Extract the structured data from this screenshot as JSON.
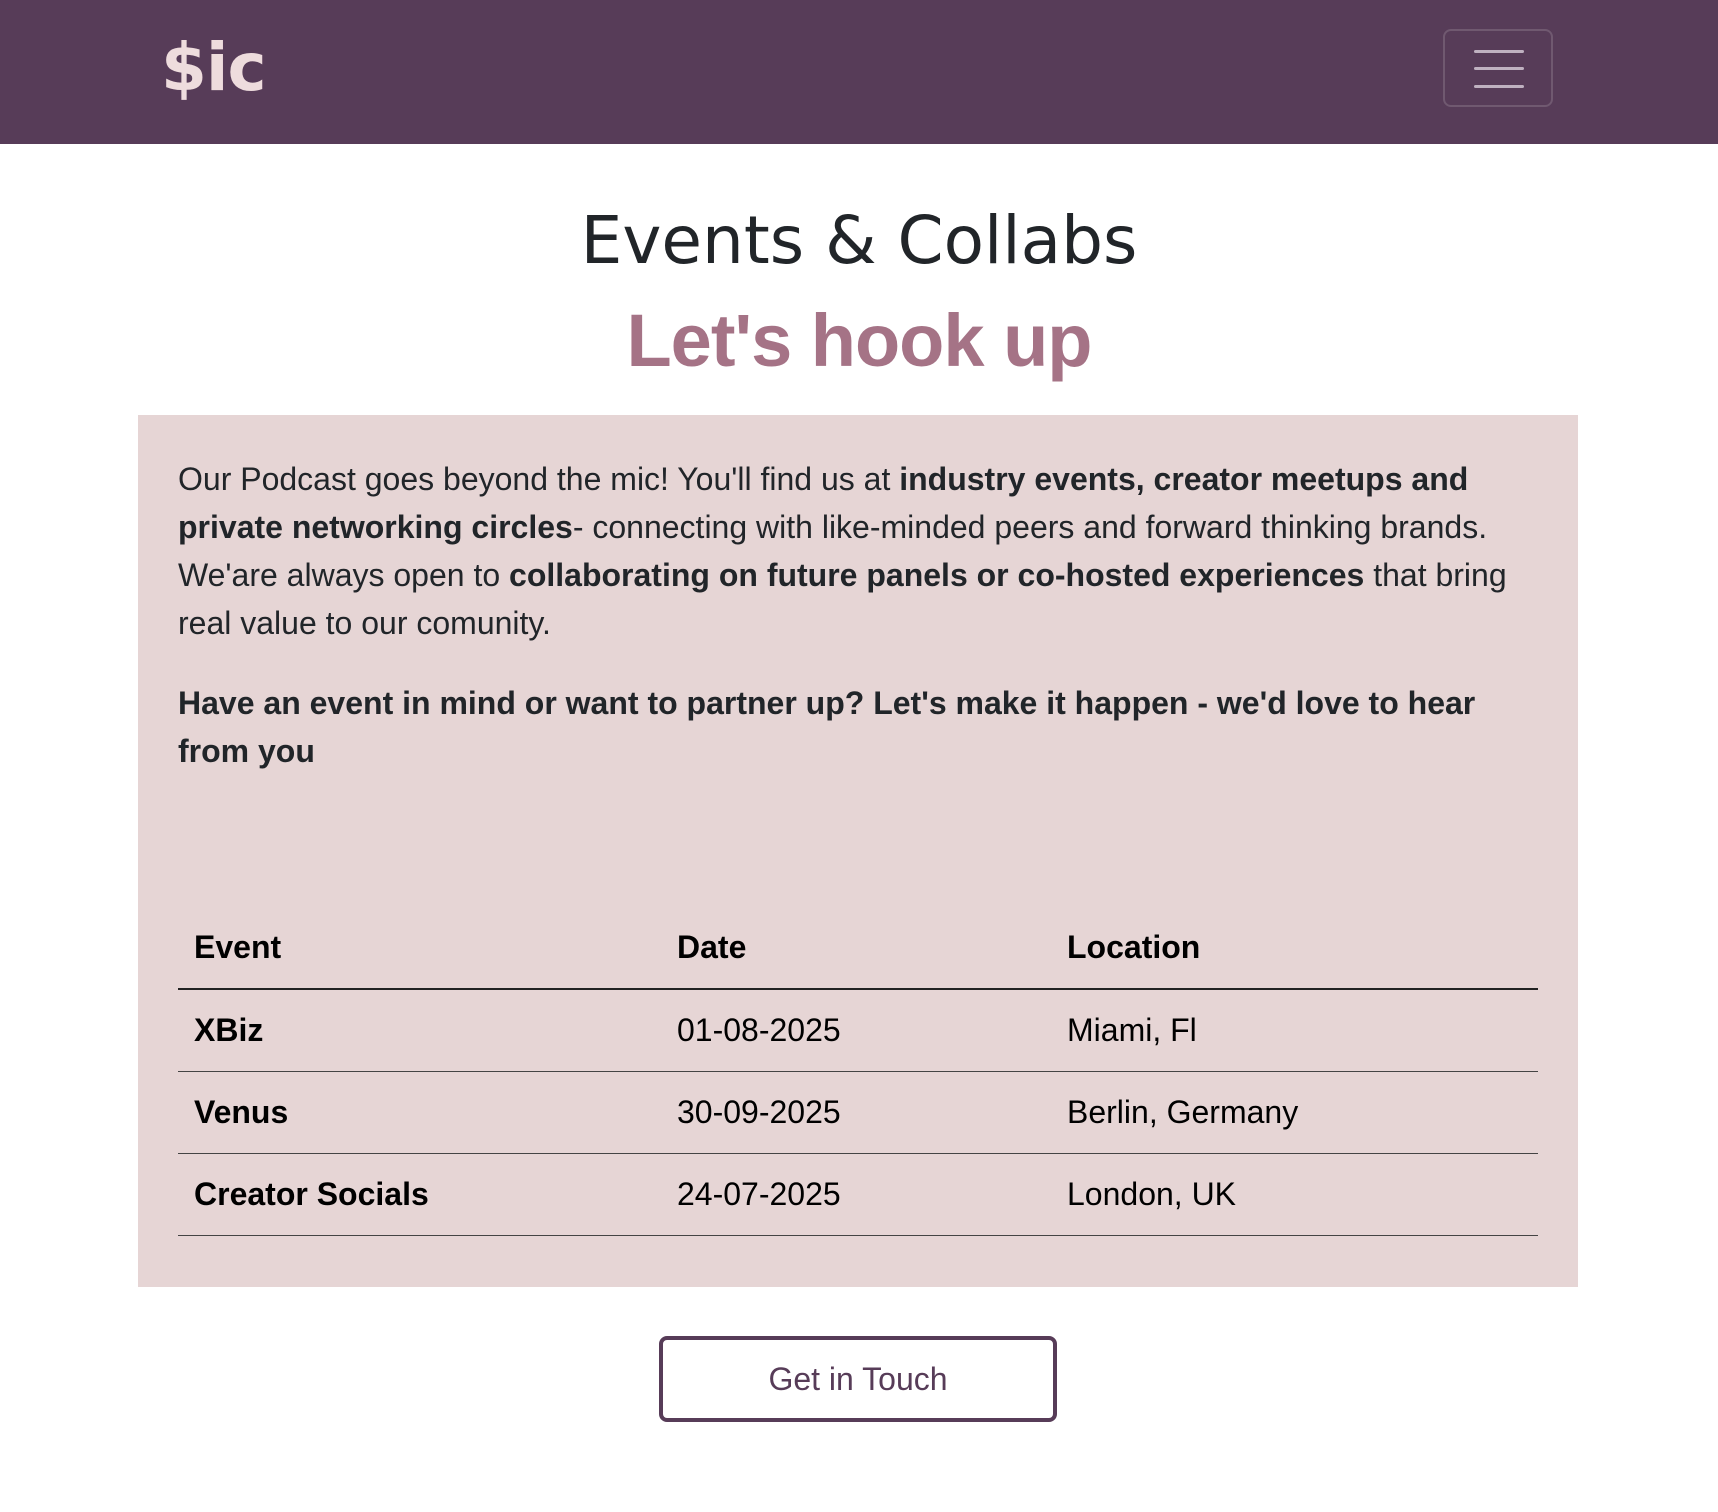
{
  "navbar": {
    "brand": "$ic",
    "toggle_icon": "hamburger-menu-icon",
    "background": "#573c58"
  },
  "hero": {
    "title": "Events & Collabs",
    "subtitle": "Let's hook up"
  },
  "intro": {
    "part1": "Our Podcast goes beyond the mic! You'll find us at ",
    "bold1": "industry events, creator meetups and private networking circles",
    "part2": "- connecting with like-minded peers and forward thinking brands. We'are always open to ",
    "bold2": "collaborating on future panels or co-hosted experiences",
    "part3": " that bring real value to our comunity."
  },
  "cta_text": "Have an event in mind or want to partner up? Let's make it happen - we'd love to hear from you",
  "table": {
    "headers": [
      "Event",
      "Date",
      "Location"
    ],
    "rows": [
      {
        "event": "XBiz",
        "date": "01-08-2025",
        "location": "Miami, Fl"
      },
      {
        "event": "Venus",
        "date": "30-09-2025",
        "location": "Berlin, Germany"
      },
      {
        "event": "Creator Socials",
        "date": "24-07-2025",
        "location": "London, UK"
      }
    ]
  },
  "button": {
    "label": "Get in Touch"
  },
  "colors": {
    "primary": "#573c58",
    "accent": "#a57386",
    "panel": "#e6d5d5"
  }
}
